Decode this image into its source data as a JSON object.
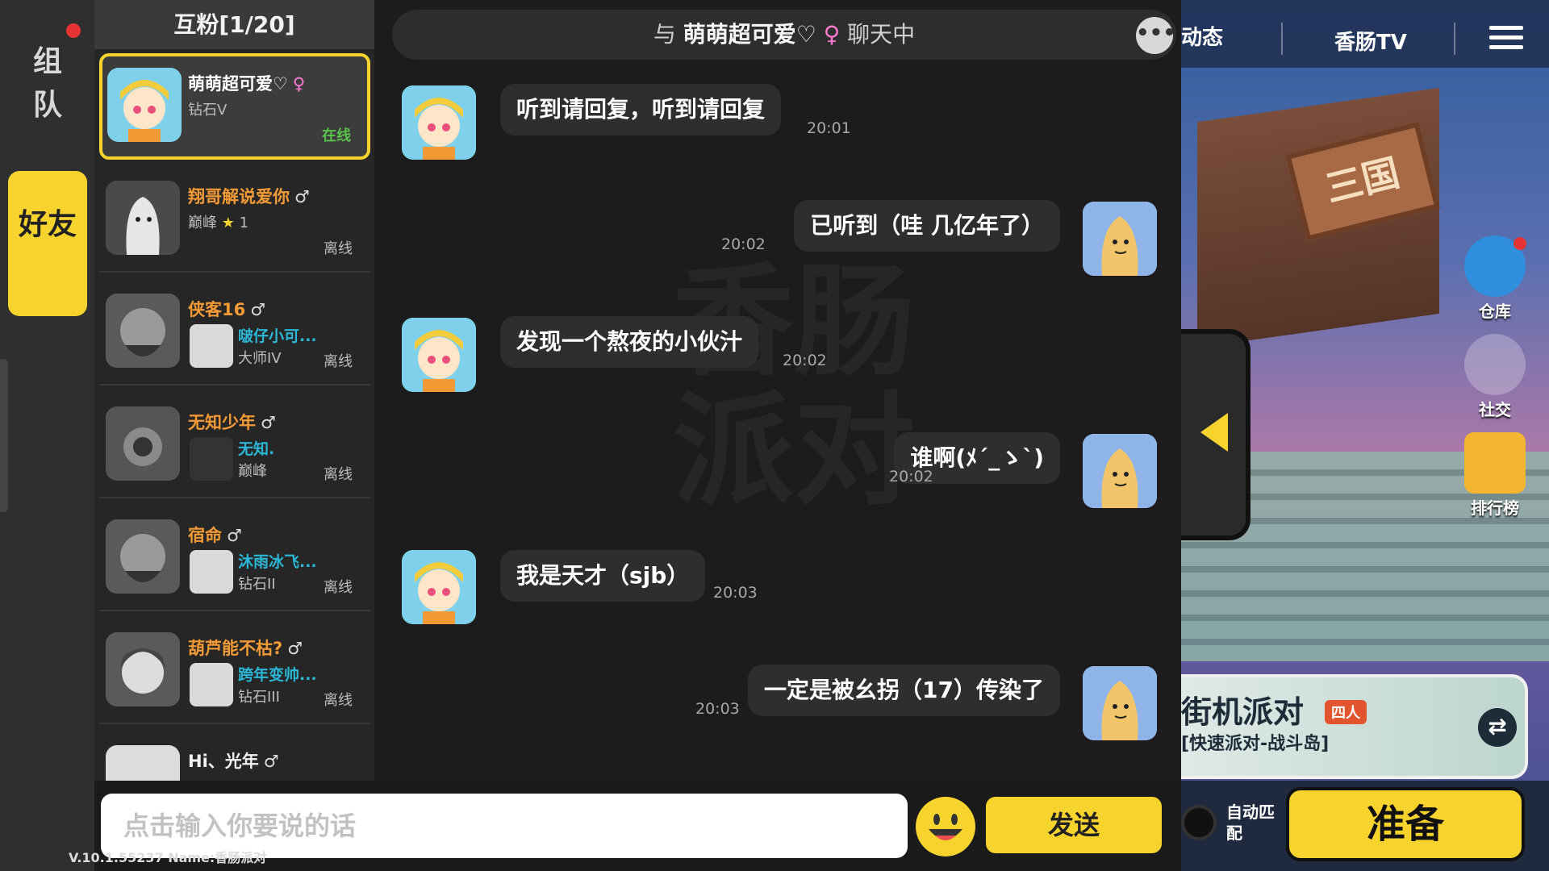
{
  "tabs": {
    "team_label": "组队",
    "friends_label": "好友"
  },
  "friend_list": {
    "header": "互粉[1/20]",
    "items": [
      {
        "name": "萌萌超可爱♡",
        "gender": "♀",
        "rank": "钻石V",
        "status": "在线"
      },
      {
        "name": "翔哥解说爱你",
        "gender": "♂",
        "rank": "巅峰",
        "star": "★",
        "star_count": "1",
        "status": "离线"
      },
      {
        "name": "侠客16",
        "gender": "♂",
        "sub_name": "啵仔小可...",
        "sub_rank": "大师IV",
        "status": "离线"
      },
      {
        "name": "无知少年",
        "gender": "♂",
        "sub_name": "无知.",
        "sub_rank": "巅峰",
        "status": "离线"
      },
      {
        "name": "宿命",
        "gender": "♂",
        "sub_name": "沐雨冰飞...",
        "sub_rank": "钻石II",
        "status": "离线"
      },
      {
        "name": "葫芦能不枯?",
        "gender": "♂",
        "sub_name": "跨年变帅...",
        "sub_rank": "钻石III",
        "status": "离线"
      },
      {
        "name": "Hi、光年",
        "gender": "♂"
      }
    ]
  },
  "chat": {
    "header_prefix": "与",
    "header_name": "萌萌超可爱♡",
    "header_gender": "♀",
    "header_suffix": "聊天中",
    "more_icon": "•••",
    "watermark": "香肠派对",
    "messages": [
      {
        "side": "left",
        "text": "听到请回复，听到请回复",
        "time": "20:01"
      },
      {
        "side": "right",
        "text": "已听到（哇  几亿年了）",
        "time": "20:02"
      },
      {
        "side": "left",
        "text": "发现一个熬夜的小伙汁",
        "time": "20:02"
      },
      {
        "side": "right",
        "text": "谁啊(ﾒ´_ゝ`)",
        "time": "20:02"
      },
      {
        "side": "left",
        "text": "我是天才（sjb）",
        "time": "20:03"
      },
      {
        "side": "right",
        "text": "一定是被幺拐（17）传染了",
        "time": "20:03"
      }
    ]
  },
  "input": {
    "placeholder": "点击输入你要说的话",
    "send_label": "发送",
    "version": "V.10.1.55237 Name:香肠派对"
  },
  "scene": {
    "nav_dynamic": "动态",
    "nav_tv": "香肠TV",
    "gate_sign": "三国",
    "side_buttons": {
      "warehouse": "仓库",
      "social": "社交",
      "leaderboard": "排行榜"
    },
    "mode_title": "街机派对",
    "mode_tag": "四人",
    "mode_sub": "[快速派对-战斗岛]",
    "swap_icon": "⇄",
    "auto_match": "自动匹配",
    "ready_label": "准备"
  },
  "colors": {
    "accent": "#f7d32e",
    "online": "#58c24a",
    "name_orange": "#f29a35",
    "sub_name_cyan": "#2bb7d6",
    "female_pink": "#ff7ad0"
  }
}
